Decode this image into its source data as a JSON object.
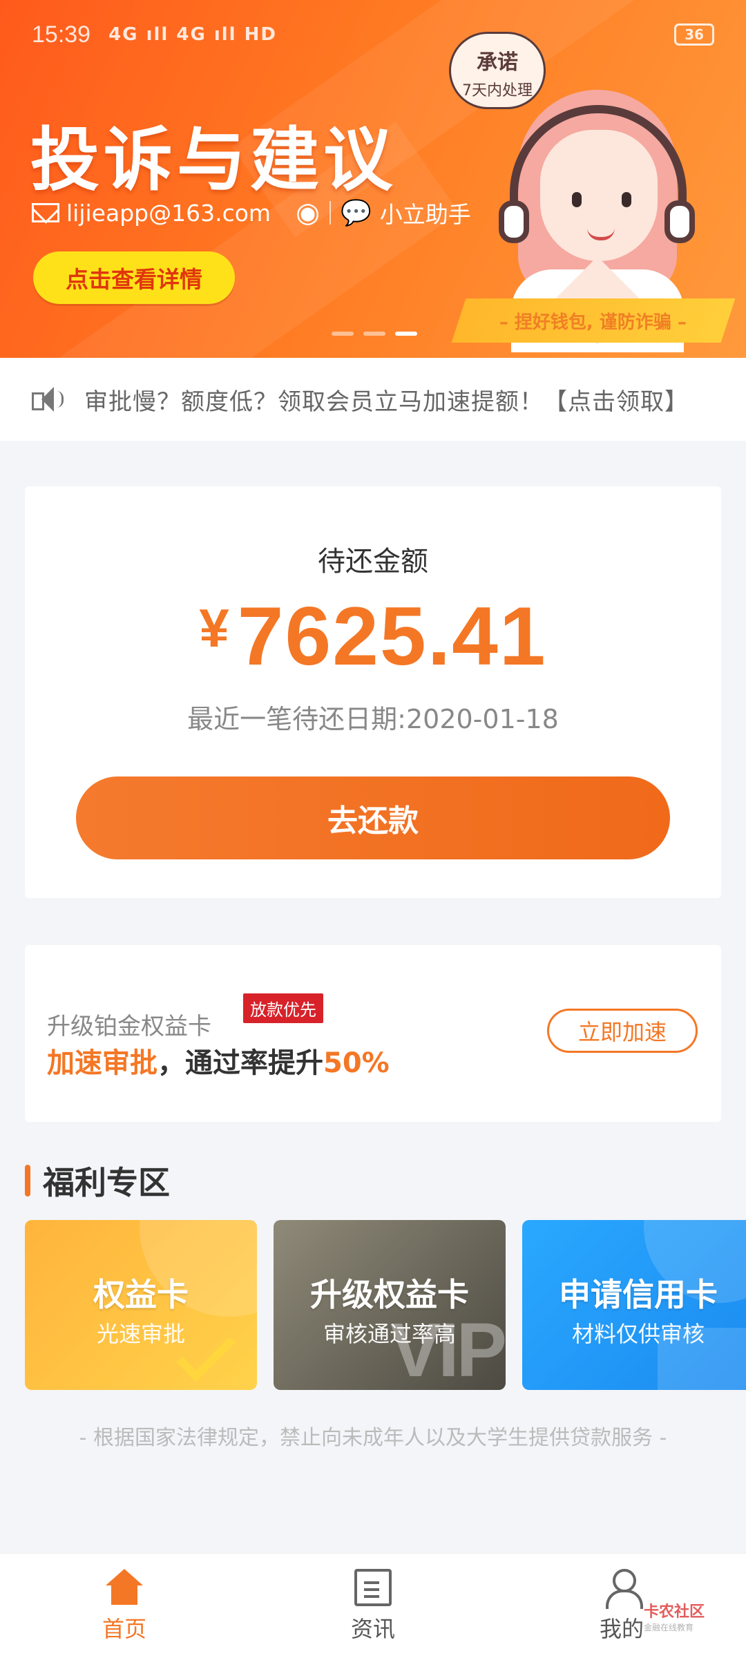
{
  "status_bar": {
    "time": "15:39",
    "signal": "4G ıll 4G ıll HD",
    "battery": "36"
  },
  "banner": {
    "title": "投诉与建议",
    "email": "lijieapp@163.com",
    "wechat_name": "小立助手",
    "detail_button": "点击查看详情",
    "promise_line1": "承诺",
    "promise_line2": "7天内处理",
    "slogan": "– 捏好钱包, 谨防诈骗 –",
    "icons": [
      "mail-icon",
      "weibo-icon",
      "wechat-icon"
    ],
    "carousel_active_index": 2,
    "carousel_count": 3
  },
  "notice": {
    "text": "审批慢？额度低？领取会员立马加速提额！【点击领取】"
  },
  "repay": {
    "label": "待还金额",
    "currency": "¥",
    "amount": "7625.41",
    "date_text": "最近一笔待还日期:2020-01-18",
    "button": "去还款"
  },
  "upgrade": {
    "title": "升级铂金权益卡",
    "tag": "放款优先",
    "desc_highlight1": "加速审批",
    "desc_middle": "，通过率提升",
    "desc_highlight2": "50%",
    "button": "立即加速"
  },
  "welfare": {
    "section_title": "福利专区",
    "cards": [
      {
        "title": "权益卡",
        "subtitle": "光速审批"
      },
      {
        "title": "升级权益卡",
        "subtitle": "审核通过率高",
        "mark": "IP"
      },
      {
        "title": "申请信用卡",
        "subtitle": "材料仅供审核"
      }
    ]
  },
  "legal_note": "- 根据国家法律规定，禁止向未成年人以及大学生提供贷款服务 -",
  "nav": {
    "items": [
      {
        "label": "首页",
        "icon": "home-icon",
        "active": true
      },
      {
        "label": "资讯",
        "icon": "news-icon",
        "active": false
      },
      {
        "label": "我的",
        "icon": "user-icon",
        "active": false
      }
    ]
  },
  "watermark": {
    "text": "卡农社区",
    "sub": "金融在线教育"
  },
  "colors": {
    "accent": "#f47725",
    "banner_start": "#ff5a1c",
    "banner_end": "#ff9a3c",
    "button_yellow": "#ffe11a",
    "tag_red": "#d7222a"
  }
}
